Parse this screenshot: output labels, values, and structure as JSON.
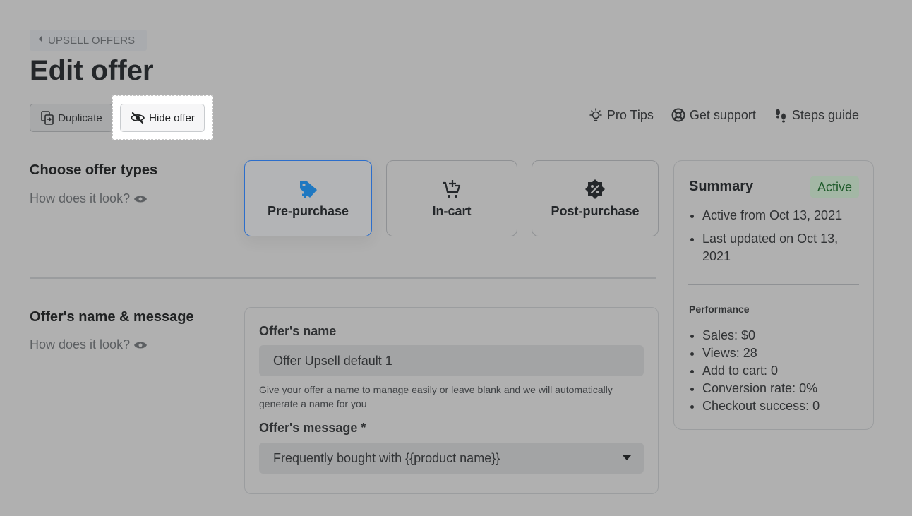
{
  "breadcrumb": {
    "label": "UPSELL OFFERS"
  },
  "page": {
    "title": "Edit offer"
  },
  "toolbar": {
    "duplicate_label": "Duplicate",
    "hide_label": "Hide offer"
  },
  "help_links": [
    {
      "label": "Pro Tips",
      "icon": "bulb-icon"
    },
    {
      "label": "Get support",
      "icon": "lifebuoy-icon"
    },
    {
      "label": "Steps guide",
      "icon": "footsteps-icon"
    }
  ],
  "offer_types": {
    "title": "Choose offer types",
    "how_look": "How does it look?",
    "types": [
      {
        "label": "Pre-purchase",
        "icon": "tag-icon",
        "selected": true
      },
      {
        "label": "In-cart",
        "icon": "cart-add-icon",
        "selected": false
      },
      {
        "label": "Post-purchase",
        "icon": "discount-badge-icon",
        "selected": false
      }
    ]
  },
  "name_message": {
    "title": "Offer's name & message",
    "how_look": "How does it look?",
    "name_label": "Offer's name",
    "name_value": "Offer Upsell default 1",
    "name_help": "Give your offer a name to manage easily or leave blank and we will automatically generate a name for you",
    "message_label": "Offer's message *",
    "message_value": "Frequently bought with {{product name}}"
  },
  "summary": {
    "title": "Summary",
    "status": "Active",
    "items": [
      "Active from Oct 13, 2021",
      "Last updated on Oct 13, 2021"
    ],
    "performance_title": "Performance",
    "performance": [
      "Sales: $0",
      "Views: 28",
      "Add to cart: 0",
      "Conversion rate: 0%",
      "Checkout success: 0"
    ]
  },
  "colors": {
    "accent": "#2c6ecb",
    "tag_icon": "#1f78c1",
    "badge_text": "#1e5a2a"
  }
}
